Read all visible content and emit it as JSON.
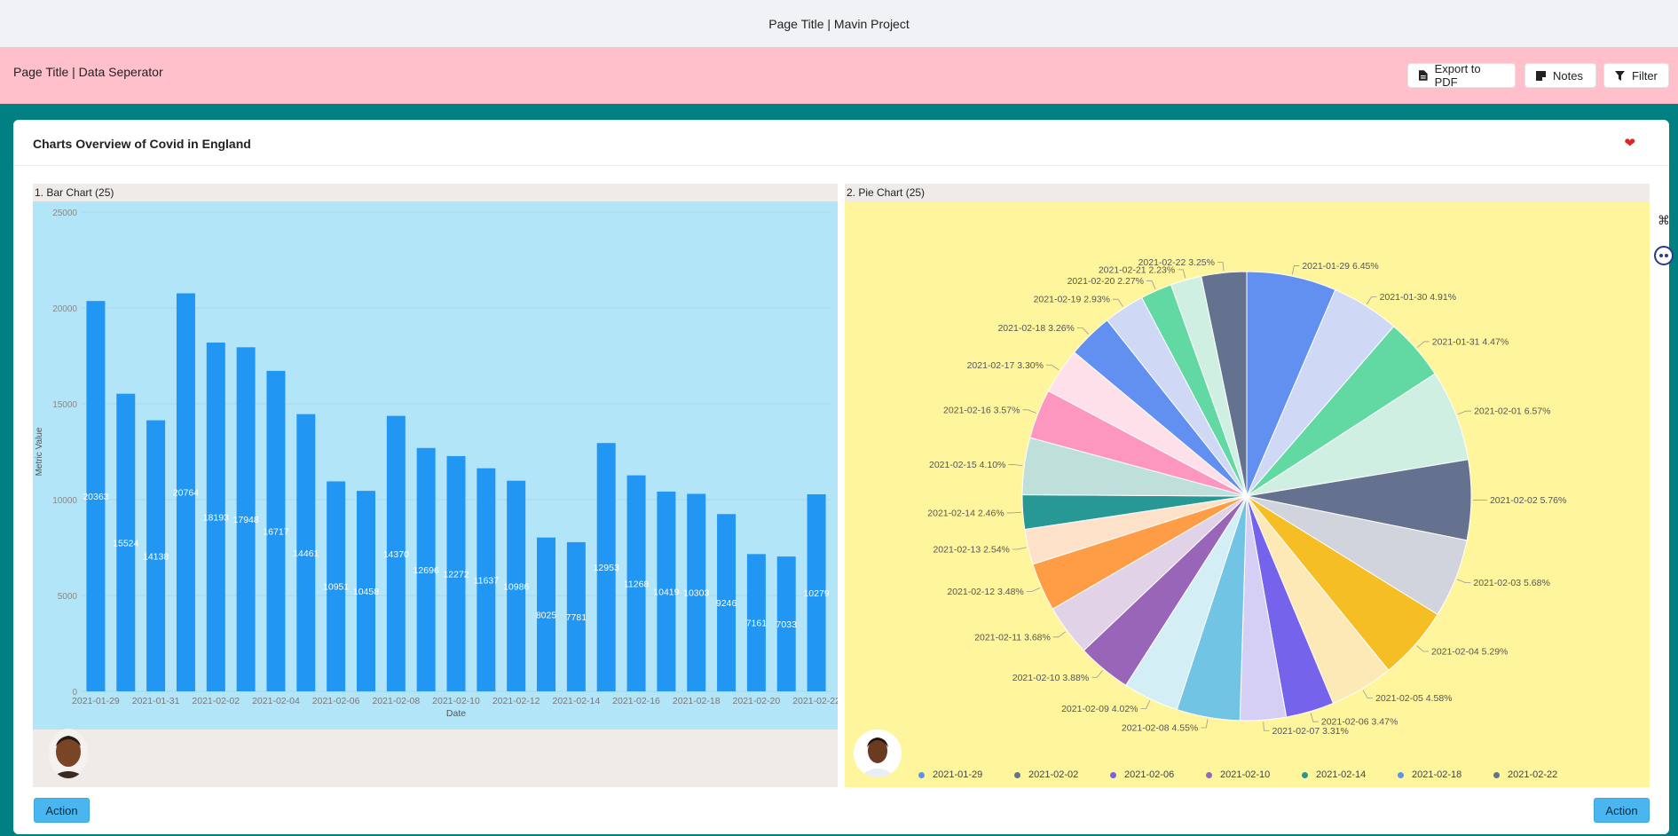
{
  "header": {
    "title": "Page Title | Mavin Project"
  },
  "subheader": {
    "title": "Page Title | Data Seperator",
    "buttons": {
      "export": "Export to PDF",
      "notes": "Notes",
      "filter": "Filter"
    }
  },
  "card": {
    "title": "Charts Overview of Covid in England"
  },
  "panels": {
    "bar_label": "1. Bar Chart (25)",
    "pie_label": "2. Pie Chart (25)"
  },
  "actions": {
    "left": "Action",
    "right": "Action"
  },
  "colors": {
    "teal": "#008080",
    "pink": "#ffc0cb",
    "bar": "#2196f3",
    "bar_bg": "#b3e5f9",
    "pie_bg": "#fff59d",
    "action": "#4ab6f0"
  },
  "chart_data": [
    {
      "type": "bar",
      "categories": [
        "2021-01-29",
        "2021-01-30",
        "2021-01-31",
        "2021-02-01",
        "2021-02-02",
        "2021-02-03",
        "2021-02-04",
        "2021-02-05",
        "2021-02-06",
        "2021-02-07",
        "2021-02-08",
        "2021-02-09",
        "2021-02-10",
        "2021-02-11",
        "2021-02-12",
        "2021-02-13",
        "2021-02-14",
        "2021-02-15",
        "2021-02-16",
        "2021-02-17",
        "2021-02-18",
        "2021-02-19",
        "2021-02-20",
        "2021-02-21",
        "2021-02-22"
      ],
      "values": [
        20363,
        15524,
        14138,
        20764,
        18193,
        17948,
        16717,
        14461,
        10951,
        10458,
        14370,
        12696,
        12272,
        11637,
        10986,
        8025,
        7781,
        12953,
        11268,
        10419,
        10303,
        9246,
        7161,
        7033,
        10279
      ],
      "x_ticks": [
        "2021-01-29",
        "2021-01-31",
        "2021-02-02",
        "2021-02-04",
        "2021-02-06",
        "2021-02-08",
        "2021-02-10",
        "2021-02-12",
        "2021-02-14",
        "2021-02-16",
        "2021-02-18",
        "2021-02-20",
        "2021-02-22"
      ],
      "y_ticks": [
        "0",
        "5000",
        "10000",
        "15000",
        "20000",
        "25000"
      ],
      "xlabel": "Date",
      "ylabel": "Metric Value",
      "ylim": [
        0,
        25000
      ]
    },
    {
      "type": "pie",
      "slices": [
        {
          "label": "2021-01-29",
          "percent": "6.45%",
          "value": 6.45,
          "color": "#6290f0"
        },
        {
          "label": "2021-01-30",
          "percent": "4.91%",
          "value": 4.91,
          "color": "#cfd9f5"
        },
        {
          "label": "2021-01-31",
          "percent": "4.47%",
          "value": 4.47,
          "color": "#62d9a2"
        },
        {
          "label": "2021-02-01",
          "percent": "6.57%",
          "value": 6.57,
          "color": "#cfefe2"
        },
        {
          "label": "2021-02-02",
          "percent": "5.76%",
          "value": 5.76,
          "color": "#65728f"
        },
        {
          "label": "2021-02-03",
          "percent": "5.68%",
          "value": 5.68,
          "color": "#d1d4dd"
        },
        {
          "label": "2021-02-04",
          "percent": "5.29%",
          "value": 5.29,
          "color": "#f5be25"
        },
        {
          "label": "2021-02-05",
          "percent": "4.58%",
          "value": 4.58,
          "color": "#fce9b6"
        },
        {
          "label": "2021-02-06",
          "percent": "3.47%",
          "value": 3.47,
          "color": "#7563ec"
        },
        {
          "label": "2021-02-07",
          "percent": "3.31%",
          "value": 3.31,
          "color": "#d5cff5"
        },
        {
          "label": "2021-02-08",
          "percent": "4.55%",
          "value": 4.55,
          "color": "#72c4e5"
        },
        {
          "label": "2021-02-09",
          "percent": "4.02%",
          "value": 4.02,
          "color": "#d3eef4"
        },
        {
          "label": "2021-02-10",
          "percent": "3.88%",
          "value": 3.88,
          "color": "#9965b8"
        },
        {
          "label": "2021-02-11",
          "percent": "3.68%",
          "value": 3.68,
          "color": "#e2d2e7"
        },
        {
          "label": "2021-02-12",
          "percent": "3.48%",
          "value": 3.48,
          "color": "#fe9d45"
        },
        {
          "label": "2021-02-13",
          "percent": "2.54%",
          "value": 2.54,
          "color": "#fde1c9"
        },
        {
          "label": "2021-02-14",
          "percent": "2.46%",
          "value": 2.46,
          "color": "#289895"
        },
        {
          "label": "2021-02-15",
          "percent": "4.10%",
          "value": 4.1,
          "color": "#bfe0da"
        },
        {
          "label": "2021-02-16",
          "percent": "3.57%",
          "value": 3.57,
          "color": "#fd97c0"
        },
        {
          "label": "2021-02-17",
          "percent": "3.30%",
          "value": 3.3,
          "color": "#fde0ea"
        },
        {
          "label": "2021-02-18",
          "percent": "3.26%",
          "value": 3.26,
          "color": "#6290f0"
        },
        {
          "label": "2021-02-19",
          "percent": "2.93%",
          "value": 2.93,
          "color": "#cfd9f5"
        },
        {
          "label": "2021-02-20",
          "percent": "2.27%",
          "value": 2.27,
          "color": "#62d9a2"
        },
        {
          "label": "2021-02-21",
          "percent": "2.23%",
          "value": 2.23,
          "color": "#cfefe2"
        },
        {
          "label": "2021-02-22",
          "percent": "3.25%",
          "value": 3.25,
          "color": "#65728f"
        }
      ],
      "legend": [
        {
          "label": "2021-01-29",
          "color": "#6290f0"
        },
        {
          "label": "2021-02-02",
          "color": "#65728f"
        },
        {
          "label": "2021-02-06",
          "color": "#7563ec"
        },
        {
          "label": "2021-02-10",
          "color": "#9965b8"
        },
        {
          "label": "2021-02-14",
          "color": "#289895"
        },
        {
          "label": "2021-02-18",
          "color": "#6290f0"
        },
        {
          "label": "2021-02-22",
          "color": "#65728f"
        }
      ]
    }
  ]
}
